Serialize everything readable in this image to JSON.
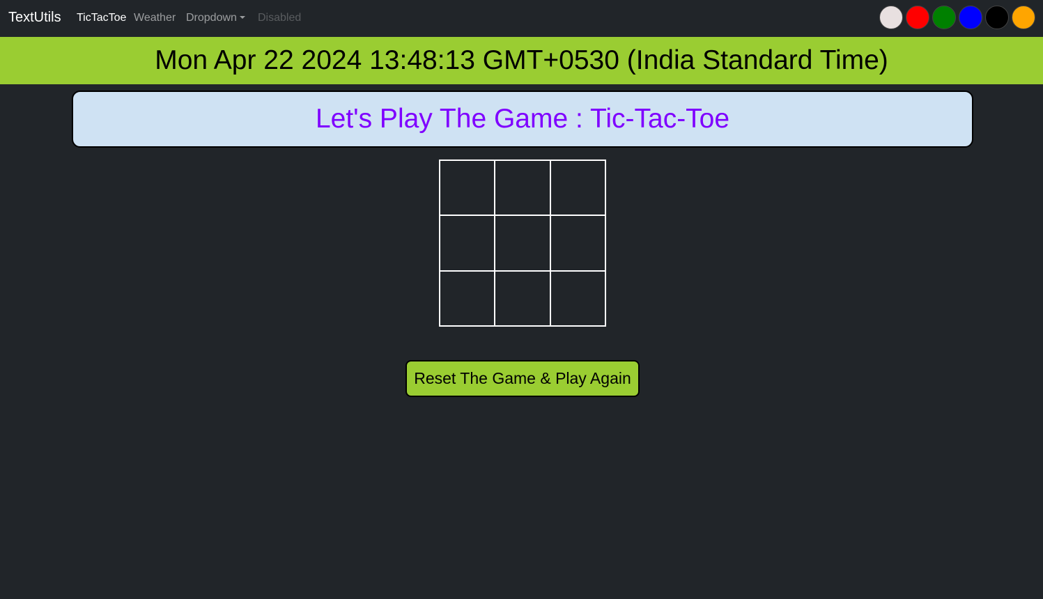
{
  "navbar": {
    "brand": "TextUtils",
    "links": [
      {
        "label": "TicTacToe",
        "state": "active"
      },
      {
        "label": "Weather",
        "state": "normal"
      },
      {
        "label": "Dropdown",
        "state": "dropdown"
      },
      {
        "label": "Disabled",
        "state": "disabled"
      }
    ],
    "theme_swatches": [
      {
        "name": "light",
        "color": "#e8e0e0"
      },
      {
        "name": "red",
        "color": "#ff0000"
      },
      {
        "name": "green",
        "color": "#008000"
      },
      {
        "name": "blue",
        "color": "#0000ff"
      },
      {
        "name": "black",
        "color": "#000000"
      },
      {
        "name": "orange",
        "color": "#ffa500"
      }
    ]
  },
  "date_banner": {
    "text": "Mon Apr 22 2024 13:48:13 GMT+0530 (India Standard Time)",
    "background": "#9acd32"
  },
  "game": {
    "title": "Let's Play The Game : Tic-Tac-Toe",
    "title_color": "#7f00ff",
    "title_background": "#cfe2f3",
    "board": [
      "",
      "",
      "",
      "",
      "",
      "",
      "",
      "",
      ""
    ],
    "reset_label": "Reset The Game & Play Again"
  },
  "colors": {
    "page_background": "#212529",
    "accent": "#9acd32"
  }
}
